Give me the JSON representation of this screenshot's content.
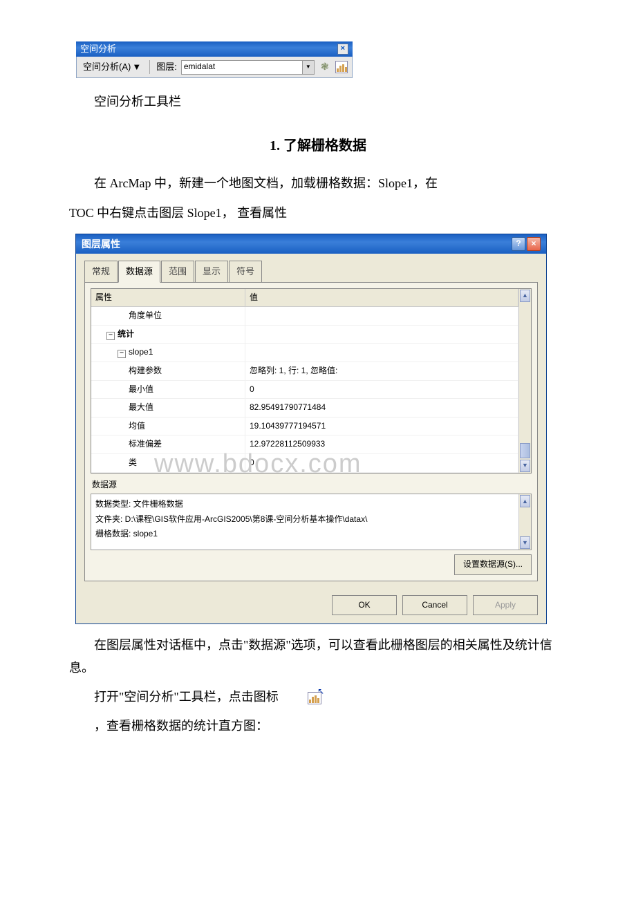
{
  "toolbar": {
    "title": "空间分析",
    "menu_label": "空间分析(A)",
    "layer_label": "图层:",
    "layer_value": "emidalat",
    "icon1_name": "options-icon",
    "icon2_name": "histogram-icon"
  },
  "caption1": "空间分析工具栏",
  "heading1": "1. 了解栅格数据",
  "para1_a": "在 ArcMap 中，新建一个地图文档，加载栅格数据：Slope1，在",
  "para1_b": "TOC 中右键点击图层 Slope1，  查看属性",
  "dialog": {
    "title": "图层属性",
    "tabs": {
      "general": "常规",
      "source": "数据源",
      "extent": "范围",
      "display": "显示",
      "symbol": "符号"
    },
    "cols": {
      "attr": "属性",
      "value": "值"
    },
    "rows": {
      "angle_unit": "角度单位",
      "stats": "统计",
      "slope1": "slope1",
      "build_params": "构建参数",
      "build_params_val": "忽略列: 1, 行: 1, 忽略值:",
      "min": "最小值",
      "min_val": "0",
      "max": "最大值",
      "max_val": "82.95491790771484",
      "mean": "均值",
      "mean_val": "19.10439777194571",
      "std": "标准偏差",
      "std_val": "12.97228112509933",
      "class": "类",
      "class_val": "0"
    },
    "datasource_label": "数据源",
    "datasource": {
      "line1": "数据类型: 文件栅格数据",
      "line2": "文件夹: D:\\课程\\GIS软件应用-ArcGIS2005\\第8课-空间分析基本操作\\datax\\",
      "line3": "栅格数据: slope1"
    },
    "btn_set_ds": "设置数据源(S)...",
    "btn_ok": "OK",
    "btn_cancel": "Cancel",
    "btn_apply": "Apply"
  },
  "watermark": "www.bdocx.com",
  "para2": "在图层属性对话框中，点击\"数据源\"选项，可以查看此栅格图层的相关属性及统计信息。",
  "para3": "打开\"空间分析\"工具栏，点击图标",
  "para4": "，查看栅格数据的统计直方图："
}
